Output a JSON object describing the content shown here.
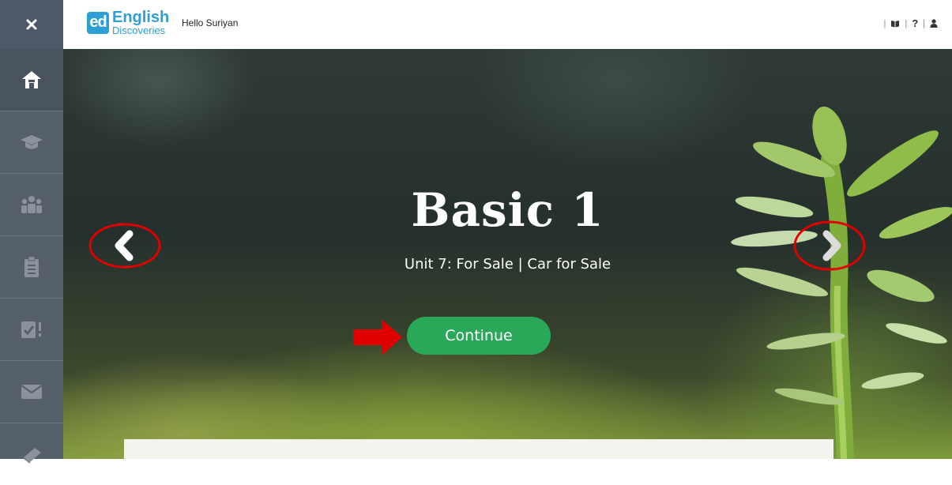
{
  "header": {
    "close_icon": "close-icon",
    "logo_badge": "ed",
    "logo_title": "English",
    "logo_sub": "Discoveries",
    "greeting": "Hello Suriyan",
    "icons": [
      "book-icon",
      "help-icon",
      "user-icon"
    ],
    "help_glyph": "?"
  },
  "sidebar": {
    "items": [
      {
        "icon": "home-icon",
        "active": true
      },
      {
        "icon": "graduation-cap-icon"
      },
      {
        "icon": "group-icon"
      },
      {
        "icon": "clipboard-icon"
      },
      {
        "icon": "assignment-check-icon"
      },
      {
        "icon": "envelope-icon"
      },
      {
        "icon": "book-icon"
      }
    ]
  },
  "hero": {
    "title": "Basic 1",
    "subtitle": "Unit 7: For Sale |  Car for Sale",
    "continue_label": "Continue",
    "prev_icon": "chevron-left-icon",
    "next_icon": "chevron-right-icon"
  },
  "colors": {
    "sidebar": "#56606d",
    "brand_blue": "#2c9fd6",
    "continue_green": "#2aa85a",
    "annotation_red": "#e00000"
  }
}
